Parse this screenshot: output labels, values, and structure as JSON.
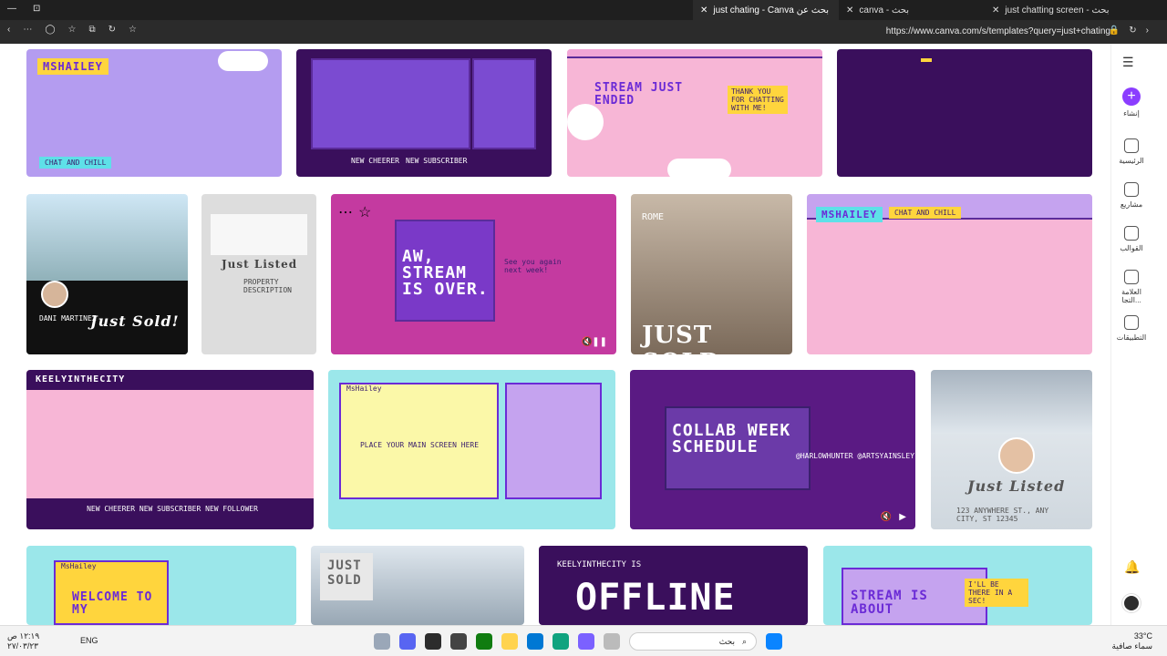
{
  "browser": {
    "tabs": [
      {
        "title": "just chating - Canva بحث عن"
      },
      {
        "title": "canva - بحث"
      },
      {
        "title": "just chatting screen - بحث"
      }
    ],
    "url": "https://www.canva.com/s/templates?query=just+chating"
  },
  "sidebar": {
    "items": [
      {
        "label": "إنشاء",
        "icon": "plus-icon"
      },
      {
        "label": "الرئيسية",
        "icon": "home-icon"
      },
      {
        "label": "مشاريع",
        "icon": "folder-icon"
      },
      {
        "label": "القوالب",
        "icon": "templates-icon"
      },
      {
        "label": "العلامة التجا...",
        "icon": "brand-icon"
      },
      {
        "label": "التطبيقات",
        "icon": "apps-icon"
      }
    ]
  },
  "templates": {
    "r1": [
      {
        "kind": "purple",
        "label": "MSHAILEY",
        "sub": "CHAT AND CHILL"
      },
      {
        "kind": "dark",
        "label": "NEW CHEERER",
        "sub": "NEW SUBSCRIBER"
      },
      {
        "kind": "pink",
        "label": "STREAM JUST ENDED",
        "sub": "THANK YOU FOR CHATTING WITH ME!"
      },
      {
        "kind": "dark2",
        "label": "",
        "sub": ""
      }
    ],
    "r2": [
      {
        "kind": "photo",
        "label": "Just Sold!",
        "sub": "DANI MARTINEZ"
      },
      {
        "kind": "listing",
        "label": "Just Listed",
        "sub": "PROPERTY DESCRIPTION"
      },
      {
        "kind": "mag",
        "label": "AW, STREAM IS OVER.",
        "sub": "See you again next week!"
      },
      {
        "kind": "room",
        "label": "JUST SOLD",
        "sub": "ROME"
      },
      {
        "kind": "lav",
        "label": "MSHAILEY",
        "sub": "CHAT AND CHILL"
      }
    ],
    "r3": [
      {
        "kind": "pinkdark",
        "label": "KEELYINTHECITY",
        "sub": "NEW CHEERER  NEW SUBSCRIBER  NEW FOLLOWER"
      },
      {
        "kind": "cyanwin",
        "label": "MsHailey",
        "sub": "PLACE YOUR MAIN SCREEN HERE"
      },
      {
        "kind": "collab",
        "label": "COLLAB WEEK SCHEDULE",
        "sub": "@HARLOWHUNTER @ARTSYAINSLEY"
      },
      {
        "kind": "listed",
        "label": "Just Listed",
        "sub": "123 ANYWHERE ST., ANY CITY, ST 12345"
      }
    ],
    "r4": [
      {
        "kind": "welcome",
        "label": "WELCOME TO MY",
        "sub": "MsHailey"
      },
      {
        "kind": "house",
        "label": "JUST SOLD",
        "sub": ""
      },
      {
        "kind": "offline",
        "label": "OFFLINE",
        "sub": "KEELYINTHECITY IS"
      },
      {
        "kind": "about",
        "label": "STREAM IS ABOUT",
        "sub": "I'LL BE THERE IN A SEC!"
      }
    ]
  },
  "taskbar": {
    "time": "١٢:١٩ ص",
    "date": "٢٧/٠٣/٢٣",
    "lang": "ENG",
    "search_placeholder": "بحث",
    "weather_temp": "33°C",
    "weather_desc": "سماء صافية"
  },
  "fab": {
    "label": "؟"
  }
}
